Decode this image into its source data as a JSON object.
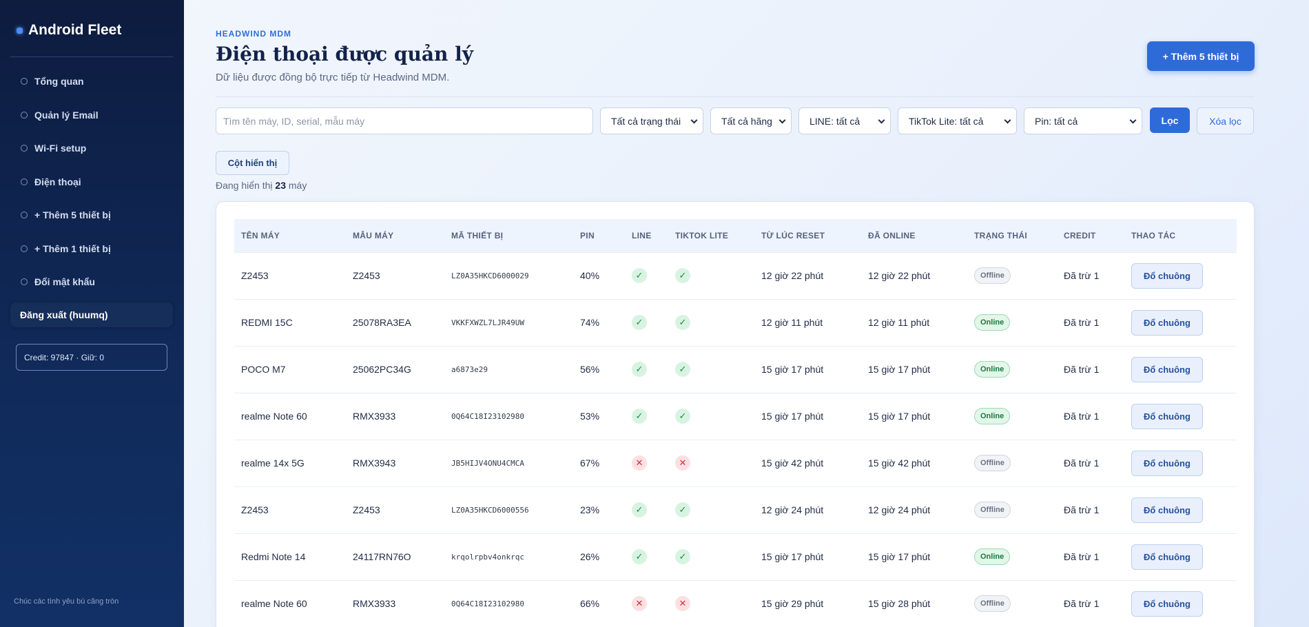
{
  "sidebar": {
    "brand": "Android Fleet",
    "items": [
      {
        "label": "Tổng quan"
      },
      {
        "label": "Quản lý Email"
      },
      {
        "label": "Wi-Fi setup"
      },
      {
        "label": "Điện thoại"
      },
      {
        "label": "+ Thêm 5 thiết bị"
      },
      {
        "label": "+ Thêm 1 thiết bị"
      },
      {
        "label": "Đổi mật khẩu"
      }
    ],
    "logout": "Đăng xuất (huumq)",
    "credit": "Credit: 97847 · Giữ: 0",
    "footer": "Chúc các tình yêu bú căng tròn"
  },
  "header": {
    "eyebrow": "HEADWIND MDM",
    "title": "Điện thoại được quản lý",
    "subtitle": "Dữ liệu được đồng bộ trực tiếp từ Headwind MDM.",
    "add_button": "+ Thêm 5 thiết bị"
  },
  "filters": {
    "search_placeholder": "Tìm tên máy, ID, serial, mẫu máy",
    "status": "Tất cả trạng thái",
    "brand": "Tất cả hãng",
    "line": "LINE: tất cả",
    "tiktok": "TikTok Lite: tất cả",
    "pin": "Pin: tất cả",
    "filter_button": "Lọc",
    "clear_button": "Xóa lọc"
  },
  "columns_button": "Cột hiển thị",
  "count": {
    "prefix": "Đang hiển thị",
    "value": "23",
    "suffix": "máy"
  },
  "table": {
    "headers": [
      "TÊN MÁY",
      "MẪU MÁY",
      "MÃ THIẾT BỊ",
      "PIN",
      "LINE",
      "TIKTOK LITE",
      "TỪ LÚC RESET",
      "ĐÃ ONLINE",
      "TRẠNG THÁI",
      "CREDIT",
      "THAO TÁC"
    ],
    "rows": [
      {
        "name": "Z2453",
        "model": "Z2453",
        "id": "LZ0A35HKCD6000029",
        "pin": "40%",
        "line": true,
        "tiktok": true,
        "reset": "12 giờ 22 phút",
        "online": "12 giờ 22 phút",
        "status": "Offline",
        "credit": "Đã trừ 1",
        "action": "Đổ chuông"
      },
      {
        "name": "REDMI 15C",
        "model": "25078RA3EA",
        "id": "VKKFXWZL7LJR49UW",
        "pin": "74%",
        "line": true,
        "tiktok": true,
        "reset": "12 giờ 11 phút",
        "online": "12 giờ 11 phút",
        "status": "Online",
        "credit": "Đã trừ 1",
        "action": "Đổ chuông"
      },
      {
        "name": "POCO M7",
        "model": "25062PC34G",
        "id": "a6873e29",
        "pin": "56%",
        "line": true,
        "tiktok": true,
        "reset": "15 giờ 17 phút",
        "online": "15 giờ 17 phút",
        "status": "Online",
        "credit": "Đã trừ 1",
        "action": "Đổ chuông"
      },
      {
        "name": "realme Note 60",
        "model": "RMX3933",
        "id": "0Q64C18I23102980",
        "pin": "53%",
        "line": true,
        "tiktok": true,
        "reset": "15 giờ 17 phút",
        "online": "15 giờ 17 phút",
        "status": "Online",
        "credit": "Đã trừ 1",
        "action": "Đổ chuông"
      },
      {
        "name": "realme 14x 5G",
        "model": "RMX3943",
        "id": "JB5HIJV4ONU4CMCA",
        "pin": "67%",
        "line": false,
        "tiktok": false,
        "reset": "15 giờ 42 phút",
        "online": "15 giờ 42 phút",
        "status": "Offline",
        "credit": "Đã trừ 1",
        "action": "Đổ chuông"
      },
      {
        "name": "Z2453",
        "model": "Z2453",
        "id": "LZ0A35HKCD6000556",
        "pin": "23%",
        "line": true,
        "tiktok": true,
        "reset": "12 giờ 24 phút",
        "online": "12 giờ 24 phút",
        "status": "Offline",
        "credit": "Đã trừ 1",
        "action": "Đổ chuông"
      },
      {
        "name": "Redmi Note 14",
        "model": "24117RN76O",
        "id": "krqolrpbv4onkrqc",
        "pin": "26%",
        "line": true,
        "tiktok": true,
        "reset": "15 giờ 17 phút",
        "online": "15 giờ 17 phút",
        "status": "Online",
        "credit": "Đã trừ 1",
        "action": "Đổ chuông"
      },
      {
        "name": "realme Note 60",
        "model": "RMX3933",
        "id": "0Q64C18I23102980",
        "pin": "66%",
        "line": false,
        "tiktok": false,
        "reset": "15 giờ 29 phút",
        "online": "15 giờ 28 phút",
        "status": "Offline",
        "credit": "Đã trừ 1",
        "action": "Đổ chuông"
      }
    ]
  }
}
